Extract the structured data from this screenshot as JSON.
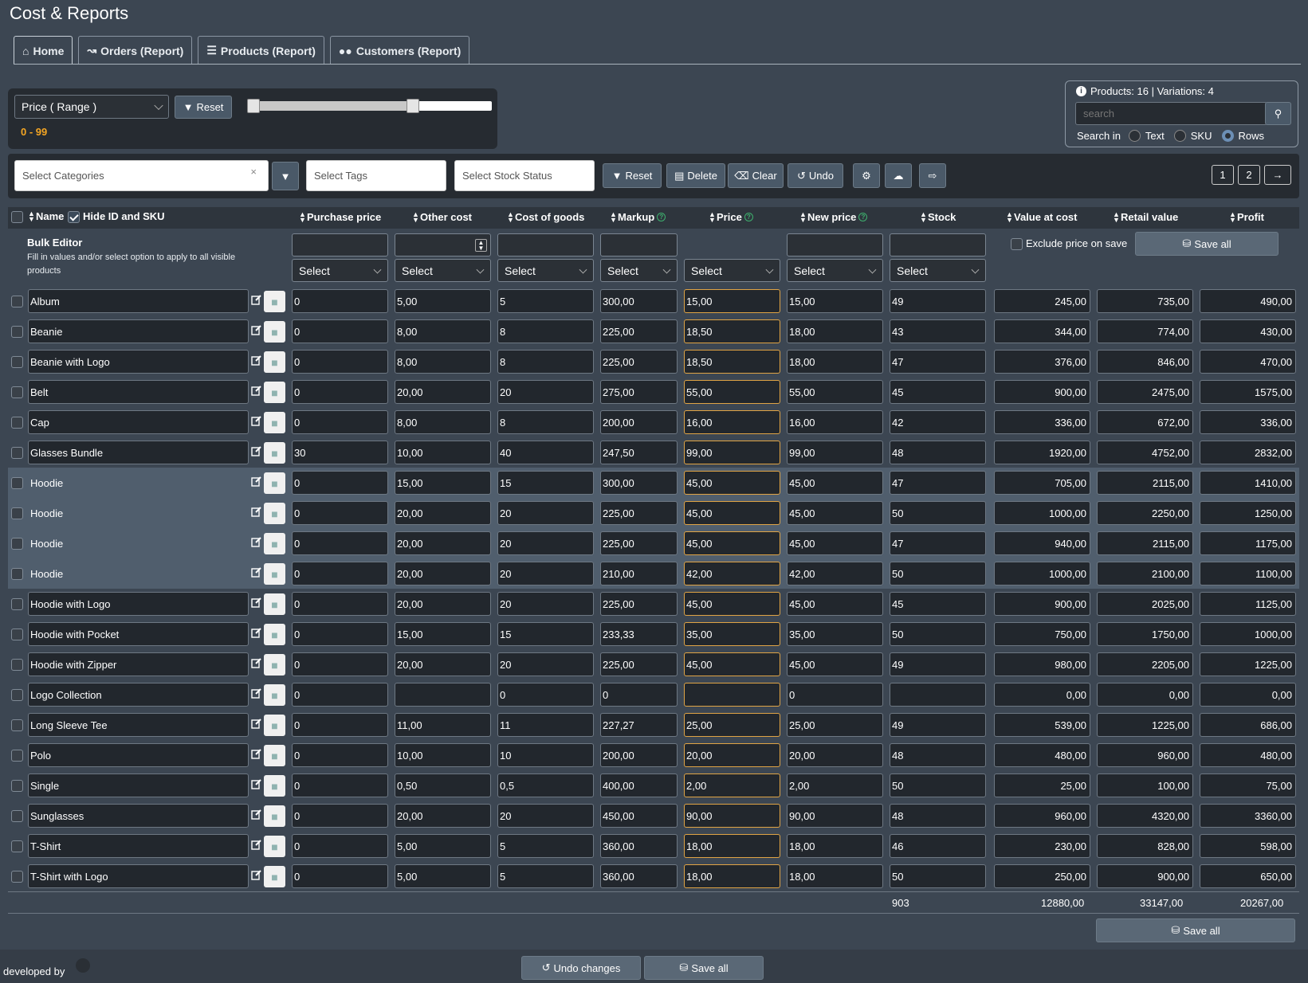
{
  "title": "Cost & Reports",
  "tabs": [
    {
      "label": "Home"
    },
    {
      "label": "Orders (Report)"
    },
    {
      "label": "Products (Report)"
    },
    {
      "label": "Customers (Report)"
    }
  ],
  "price_filter": {
    "select": "Price ( Range )",
    "reset": "Reset",
    "range_text": "0 - 99",
    "range_min": 0,
    "range_max": 99
  },
  "info": {
    "counts": "Products: 16 | Variations: 4",
    "search_placeholder": "search",
    "search_in": "Search in",
    "opt_text": "Text",
    "opt_sku": "SKU",
    "opt_rows": "Rows",
    "selected": "Rows"
  },
  "filters": {
    "categories": "Select Categories",
    "clear_x": "×",
    "tags": "Select Tags",
    "stock": "Select Stock Status",
    "reset": "Reset",
    "delete": "Delete",
    "clear": "Clear",
    "undo": "Undo",
    "pages": [
      "1",
      "2"
    ]
  },
  "columns": {
    "name": "Name",
    "hide_id": "Hide ID and SKU",
    "purchase": "Purchase price",
    "other": "Other cost",
    "cog": "Cost of goods",
    "markup": "Markup",
    "price": "Price",
    "new_price": "New price",
    "stock": "Stock",
    "value_cost": "Value at cost",
    "retail": "Retail value",
    "profit": "Profit"
  },
  "bulk": {
    "title": "Bulk Editor",
    "subtitle": "Fill in values and/or select option to apply to all visible products",
    "select": "Select",
    "exclude": "Exclude price on save",
    "save_all": "Save all"
  },
  "rows": [
    {
      "name": "Album",
      "purchase": "0",
      "other": "5,00",
      "cog": "5",
      "markup": "300,00",
      "price": "15,00",
      "new_price": "15,00",
      "stock": "49",
      "value_cost": "245,00",
      "retail": "735,00",
      "profit": "490,00",
      "variation": false,
      "thumb": "album-icon"
    },
    {
      "name": "Beanie",
      "purchase": "0",
      "other": "8,00",
      "cog": "8",
      "markup": "225,00",
      "price": "18,50",
      "new_price": "18,00",
      "stock": "43",
      "value_cost": "344,00",
      "retail": "774,00",
      "profit": "430,00",
      "variation": false,
      "thumb": "beanie-icon"
    },
    {
      "name": "Beanie with Logo",
      "purchase": "0",
      "other": "8,00",
      "cog": "8",
      "markup": "225,00",
      "price": "18,50",
      "new_price": "18,00",
      "stock": "47",
      "value_cost": "376,00",
      "retail": "846,00",
      "profit": "470,00",
      "variation": false,
      "thumb": "beanie-icon"
    },
    {
      "name": "Belt",
      "purchase": "0",
      "other": "20,00",
      "cog": "20",
      "markup": "275,00",
      "price": "55,00",
      "new_price": "55,00",
      "stock": "45",
      "value_cost": "900,00",
      "retail": "2475,00",
      "profit": "1575,00",
      "variation": false,
      "thumb": "belt-icon"
    },
    {
      "name": "Cap",
      "purchase": "0",
      "other": "8,00",
      "cog": "8",
      "markup": "200,00",
      "price": "16,00",
      "new_price": "16,00",
      "stock": "42",
      "value_cost": "336,00",
      "retail": "672,00",
      "profit": "336,00",
      "variation": false,
      "thumb": "cap-icon"
    },
    {
      "name": "Glasses Bundle",
      "purchase": "30",
      "other": "10,00",
      "cog": "40",
      "markup": "247,50",
      "price": "99,00",
      "new_price": "99,00",
      "stock": "48",
      "value_cost": "1920,00",
      "retail": "4752,00",
      "profit": "2832,00",
      "variation": false,
      "thumb": "image-placeholder-icon"
    },
    {
      "name": "Hoodie",
      "purchase": "0",
      "other": "15,00",
      "cog": "15",
      "markup": "300,00",
      "price": "45,00",
      "new_price": "45,00",
      "stock": "47",
      "value_cost": "705,00",
      "retail": "2115,00",
      "profit": "1410,00",
      "variation": true,
      "thumb": "hoodie-icon"
    },
    {
      "name": "Hoodie",
      "purchase": "0",
      "other": "20,00",
      "cog": "20",
      "markup": "225,00",
      "price": "45,00",
      "new_price": "45,00",
      "stock": "50",
      "value_cost": "1000,00",
      "retail": "2250,00",
      "profit": "1250,00",
      "variation": true,
      "thumb": "hoodie-icon"
    },
    {
      "name": "Hoodie",
      "purchase": "0",
      "other": "20,00",
      "cog": "20",
      "markup": "225,00",
      "price": "45,00",
      "new_price": "45,00",
      "stock": "47",
      "value_cost": "940,00",
      "retail": "2115,00",
      "profit": "1175,00",
      "variation": true,
      "thumb": "hoodie-icon"
    },
    {
      "name": "Hoodie",
      "purchase": "0",
      "other": "20,00",
      "cog": "20",
      "markup": "210,00",
      "price": "42,00",
      "new_price": "42,00",
      "stock": "50",
      "value_cost": "1000,00",
      "retail": "2100,00",
      "profit": "1100,00",
      "variation": true,
      "thumb": "hoodie-icon"
    },
    {
      "name": "Hoodie with Logo",
      "purchase": "0",
      "other": "20,00",
      "cog": "20",
      "markup": "225,00",
      "price": "45,00",
      "new_price": "45,00",
      "stock": "45",
      "value_cost": "900,00",
      "retail": "2025,00",
      "profit": "1125,00",
      "variation": false,
      "thumb": "hoodie-icon"
    },
    {
      "name": "Hoodie with Pocket",
      "purchase": "0",
      "other": "15,00",
      "cog": "15",
      "markup": "233,33",
      "price": "35,00",
      "new_price": "35,00",
      "stock": "50",
      "value_cost": "750,00",
      "retail": "1750,00",
      "profit": "1000,00",
      "variation": false,
      "thumb": "hoodie-icon"
    },
    {
      "name": "Hoodie with Zipper",
      "purchase": "0",
      "other": "20,00",
      "cog": "20",
      "markup": "225,00",
      "price": "45,00",
      "new_price": "45,00",
      "stock": "49",
      "value_cost": "980,00",
      "retail": "2205,00",
      "profit": "1225,00",
      "variation": false,
      "thumb": "hoodie-icon"
    },
    {
      "name": "Logo Collection",
      "purchase": "0",
      "other": "",
      "cog": "0",
      "markup": "0",
      "price": "",
      "new_price": "0",
      "stock": "",
      "value_cost": "0,00",
      "retail": "0,00",
      "profit": "0,00",
      "variation": false,
      "thumb": "collection-icon"
    },
    {
      "name": "Long Sleeve Tee",
      "purchase": "0",
      "other": "11,00",
      "cog": "11",
      "markup": "227,27",
      "price": "25,00",
      "new_price": "25,00",
      "stock": "49",
      "value_cost": "539,00",
      "retail": "1225,00",
      "profit": "686,00",
      "variation": false,
      "thumb": "tshirt-icon"
    },
    {
      "name": "Polo",
      "purchase": "0",
      "other": "10,00",
      "cog": "10",
      "markup": "200,00",
      "price": "20,00",
      "new_price": "20,00",
      "stock": "48",
      "value_cost": "480,00",
      "retail": "960,00",
      "profit": "480,00",
      "variation": false,
      "thumb": "tshirt-icon"
    },
    {
      "name": "Single",
      "purchase": "0",
      "other": "0,50",
      "cog": "0,5",
      "markup": "400,00",
      "price": "2,00",
      "new_price": "2,00",
      "stock": "50",
      "value_cost": "25,00",
      "retail": "100,00",
      "profit": "75,00",
      "variation": false,
      "thumb": "album-icon"
    },
    {
      "name": "Sunglasses",
      "purchase": "0",
      "other": "20,00",
      "cog": "20",
      "markup": "450,00",
      "price": "90,00",
      "new_price": "90,00",
      "stock": "48",
      "value_cost": "960,00",
      "retail": "4320,00",
      "profit": "3360,00",
      "variation": false,
      "thumb": "sunglasses-icon"
    },
    {
      "name": "T-Shirt",
      "purchase": "0",
      "other": "5,00",
      "cog": "5",
      "markup": "360,00",
      "price": "18,00",
      "new_price": "18,00",
      "stock": "46",
      "value_cost": "230,00",
      "retail": "828,00",
      "profit": "598,00",
      "variation": false,
      "thumb": "tshirt-icon"
    },
    {
      "name": "T-Shirt with Logo",
      "purchase": "0",
      "other": "5,00",
      "cog": "5",
      "markup": "360,00",
      "price": "18,00",
      "new_price": "18,00",
      "stock": "50",
      "value_cost": "250,00",
      "retail": "900,00",
      "profit": "650,00",
      "variation": false,
      "thumb": "tshirt-icon"
    }
  ],
  "totals": {
    "stock": "903",
    "value_cost": "12880,00",
    "retail": "33147,00",
    "profit": "20267,00"
  },
  "save_all": "Save all",
  "footer": {
    "developed_by": "developed by",
    "undo_changes": "Undo changes",
    "save_all": "Save all"
  },
  "colors": {
    "background": "#3c4652",
    "panel": "#262b31",
    "price_border": "#e0a445",
    "range_text": "#f5a623",
    "help_icon": "#3eb06e",
    "variation_row": "#505e6d"
  }
}
